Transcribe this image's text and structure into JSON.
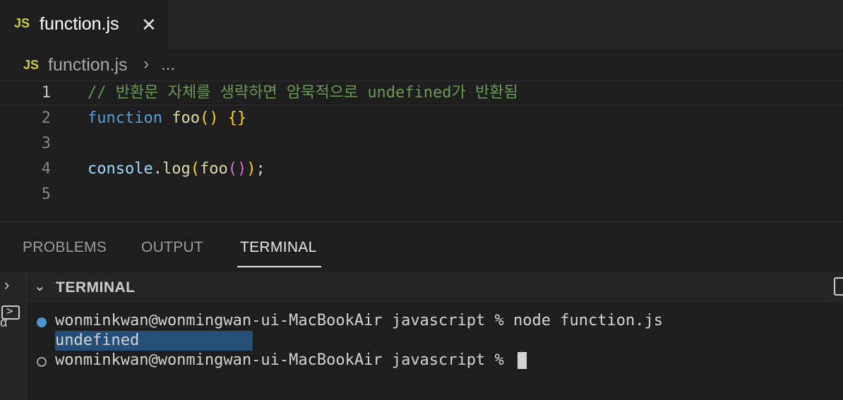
{
  "tab": {
    "badge": "JS",
    "title": "function.js",
    "close": "✕"
  },
  "breadcrumb": {
    "badge": "JS",
    "file": "function.js",
    "separator": "›",
    "more": "..."
  },
  "editor": {
    "lines": [
      {
        "num": "1",
        "comment": "// 반환문 자체를 생략하면 암묵적으로 undefined가 반환됨"
      },
      {
        "num": "2",
        "kw": "function",
        "name": "foo",
        "parens": "()",
        "braces": "{}"
      },
      {
        "num": "3"
      },
      {
        "num": "4",
        "obj": "console",
        "dot": ".",
        "method": "log",
        "open": "(",
        "arg": "foo",
        "innerparens": "()",
        "close": ")",
        "semi": ";"
      },
      {
        "num": "5"
      }
    ]
  },
  "panel": {
    "tabs": [
      "PROBLEMS",
      "OUTPUT",
      "TERMINAL"
    ],
    "active_tab": "TERMINAL",
    "section_title": "TERMINAL",
    "terminal": {
      "line1": "wonminkwan@wonmingwan-ui-MacBookAir javascript % node function.js",
      "line2": "undefined",
      "line3": "wonminkwan@wonmingwan-ui-MacBookAir javascript % "
    }
  },
  "colors": {
    "accent": "#4e94ce",
    "comment": "#6a9955",
    "keyword": "#569cd6",
    "function": "#dcdcaa",
    "selection": "#264f78"
  }
}
